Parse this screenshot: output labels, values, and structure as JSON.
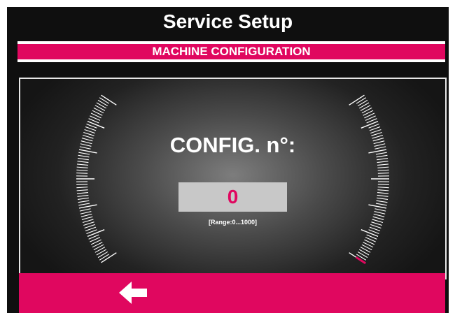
{
  "header": {
    "title": "Service Setup"
  },
  "section": {
    "title": "MACHINE CONFIGURATION"
  },
  "config": {
    "label": "CONFIG. n°:",
    "value": "0",
    "range_text": "[Range:0...1000]",
    "gauge_level": 0
  },
  "footer": {
    "back_icon": "arrow-left-icon"
  },
  "colors": {
    "accent": "#e0075f",
    "background": "#0f0f0f",
    "text": "#ffffff",
    "value_box": "#c8c8c8"
  }
}
